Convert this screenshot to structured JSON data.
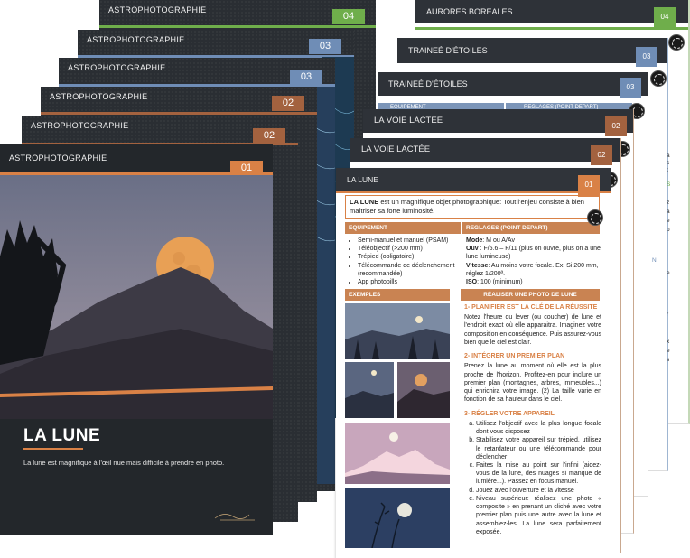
{
  "cards": [
    {
      "id": "c6",
      "title": "ASTROPHOTOGRAPHIE",
      "num": "04",
      "num_color": "#6fae4b"
    },
    {
      "id": "c5",
      "title": "ASTROPHOTOGRAPHIE",
      "num": "03",
      "num_color": "#6f8db6"
    },
    {
      "id": "c4",
      "title": "ASTROPHOTOGRAPHIE",
      "num": "03",
      "num_color": "#6f8db6"
    },
    {
      "id": "c3",
      "title": "ASTROPHOTOGRAPHIE",
      "num": "02",
      "num_color": "#a3623f"
    },
    {
      "id": "c2",
      "title": "ASTROPHOTOGRAPHIE",
      "num": "02",
      "num_color": "#a3623f"
    },
    {
      "id": "c1",
      "title": "ASTROPHOTOGRAPHIE",
      "num": "01",
      "num_color": "#d98146"
    }
  ],
  "front_card": {
    "big_title": "LA LUNE",
    "caption": "La lune est magnifique à l'œil nue mais difficile à prendre en photo.",
    "accent": "#d98146"
  },
  "sheets": [
    {
      "id": "s6",
      "title": "AURORES BOREALES",
      "num": "04",
      "num_color": "#6fae4b"
    },
    {
      "id": "s5",
      "title": "TRAINEÉ D'ÉTOILES",
      "num": "03",
      "num_color": "#6f8db6"
    },
    {
      "id": "s4",
      "title": "TRAINEÉ D'ÉTOILES",
      "num": "03",
      "num_color": "#6f8db6"
    },
    {
      "id": "s3",
      "title": "LA VOIE LACTÉE",
      "num": "02",
      "num_color": "#a3623f"
    },
    {
      "id": "s2",
      "title": "LA VOIE LACTÉE",
      "num": "02",
      "num_color": "#a3623f"
    },
    {
      "id": "s1",
      "title": "LA LUNE",
      "num": "01",
      "num_color": "#d98146"
    }
  ],
  "peek_headers": {
    "equipement": "EQUIPEMENT",
    "reglages": "REGLAGES (POINT DEPART)"
  },
  "lune_sheet": {
    "intro_strong": "LA LUNE",
    "intro_rest": " est un magnifique objet photographique: Tout l'enjeu consiste à bien maîtriser sa forte luminosité.",
    "equip_title": "EQUIPEMENT",
    "equip_items": [
      "Semi-manuel et manuel (PSAM)",
      "Téléobjectif (>200 mm)",
      "Trépied (obligatoire)",
      "Télécommande de déclenchement (recommandée)",
      "App photopills"
    ],
    "reg_title": "REGLAGES (POINT DEPART)",
    "reg_items": [
      {
        "k": "Mode",
        "v": ": M ou A/Av"
      },
      {
        "k": "Ouv",
        "v": " : F/5.6 – F/11 (plus on ouvre, plus on a une lune lumineuse)"
      },
      {
        "k": "Vitesse",
        "v": ": Au moins votre focale. Ex: Si 200 mm, réglez 1/200ª."
      },
      {
        "k": "ISO",
        "v": ": 100 (minimum)"
      }
    ],
    "ex_title": "EXEMPLES",
    "real_title": "RÉALISER UNE PHOTO DE LUNE",
    "step1_title": "1- PLANIFIER EST LA CLÉ DE LA RÉUSSITE",
    "step1_text": "Notez l'heure du lever (ou coucher) de lune et l'endroit exact où elle apparaitra. Imaginez votre composition en conséquence. Puis assurez-vous bien que le ciel est clair.",
    "step2_title": "2- INTÉGRER UN PREMIER PLAN",
    "step2_text": "Prenez la lune au moment où elle est la plus proche de l'horizon. Profitez-en pour inclure un premier plan (montagnes, arbres, immeubles...) qui enrichira votre image. (2) La taille varie en fonction de sa hauteur dans le ciel.",
    "step3_title": "3- RÉGLER VOTRE APPAREIL",
    "step3_items": [
      "Utilisez l'objectif avec la plus longue focale dont vous disposez",
      "Stabilisez votre appareil sur trépied, utilisez le retardateur ou une télécommande pour déclencher",
      "Faites la mise au point sur l'infini (aidez-vous de la lune, des nuages si manque de lumière...). Passez en focus manuel.",
      "Jouez avec l'ouverture et la vitesse",
      "Niveau supérieur: réalisez une photo « composite » en prenant un cliché avec votre premier plan puis une autre avec la lune et assemblez-les. La lune sera parfaitement exposée."
    ]
  },
  "edge_letters": [
    "l",
    "a",
    "s",
    "t",
    "z",
    "a",
    "e",
    "p",
    "S",
    "N",
    "e",
    "r",
    "x",
    "e",
    "s"
  ]
}
